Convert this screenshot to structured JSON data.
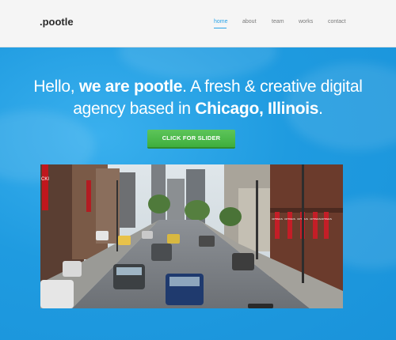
{
  "brand": {
    "logo": ".pootle"
  },
  "nav": {
    "items": [
      {
        "label": "home",
        "active": true
      },
      {
        "label": "about",
        "active": false
      },
      {
        "label": "team",
        "active": false
      },
      {
        "label": "works",
        "active": false
      },
      {
        "label": "contact",
        "active": false
      }
    ]
  },
  "hero": {
    "line1_pre": "Hello, ",
    "line1_bold": "we are pootle",
    "line1_post": ". A fresh & creative digital",
    "line2_pre": "agency based in ",
    "line2_bold": "Chicago, Illinois",
    "line2_post": ".",
    "cta_label": "CLICK FOR SLIDER"
  },
  "photo": {
    "signs": [
      "CKI",
      "OPTIMUS",
      "OPTIMUS",
      "OPTIMUS",
      "OPTIMUS",
      "OPTIMUS"
    ]
  },
  "colors": {
    "accent": "#29a3e8",
    "hero_bg": "#1e9be0",
    "cta_green": "#4db84b",
    "topbar": "#f5f5f5"
  }
}
